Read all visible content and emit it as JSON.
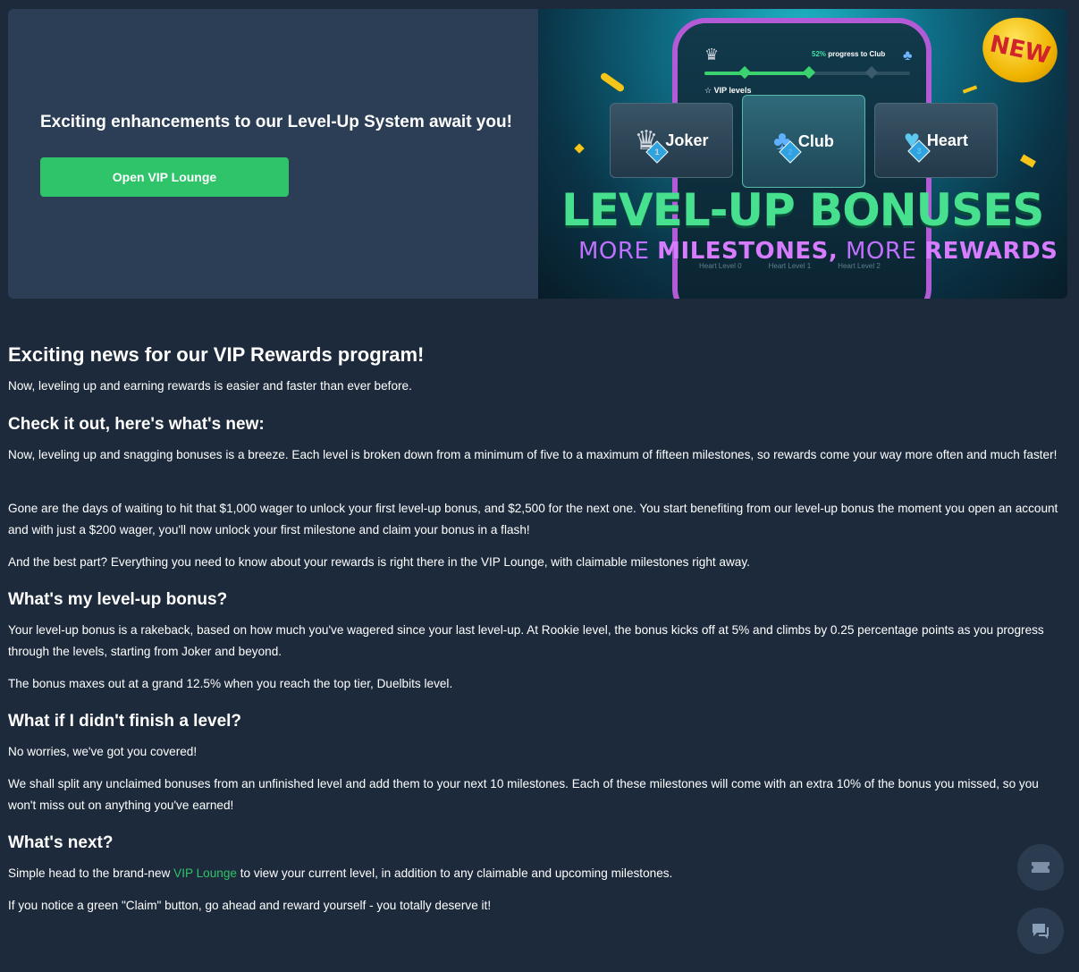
{
  "banner": {
    "title": "Exciting enhancements to our Level-Up System await you!",
    "button_label": "Open VIP Lounge",
    "art": {
      "progress_pct": "52%",
      "progress_suffix": " progress to Club",
      "progress_value": 0.52,
      "vip_levels_label": "VIP levels",
      "cards": [
        {
          "label": "Joker",
          "badge": "1",
          "icon": "crown-icon"
        },
        {
          "label": "Club",
          "badge": "2",
          "icon": "club-icon"
        },
        {
          "label": "Heart",
          "badge": "3",
          "icon": "heart-icon"
        }
      ],
      "headline": "LEVEL-UP BONUSES",
      "subline_more1": "MORE ",
      "subline_milestones": "MILESTONES,",
      "subline_more2": " MORE ",
      "subline_rewards": "REWARDS",
      "heart_levels": [
        "Heart Level 0",
        "Heart Level 1",
        "Heart Level 2"
      ],
      "new_badge": "NEW"
    }
  },
  "article": {
    "h1": "Exciting news for our VIP Rewards program!",
    "p1": "Now, leveling up and earning rewards is easier and faster than ever before.",
    "h2_1": "Check it out, here's what's new:",
    "p2": "Now, leveling up and snagging bonuses is a breeze. Each level is broken down from a minimum of five to a maximum of fifteen milestones, so rewards come your way more often and much faster!",
    "p3": "Gone are the days of waiting to hit that $1,000 wager to unlock your first level-up bonus, and $2,500 for the next one. You start benefiting from our level-up bonus the moment you open an account and with just a $200 wager, you'll now unlock your first milestone and claim your bonus in a flash!",
    "p4": "And the best part? Everything you need to know about your rewards is right there in the VIP Lounge, with claimable milestones right away.",
    "h2_2": "What's my level-up bonus?",
    "p5": "Your level-up bonus is a rakeback, based on how much you've wagered since your last level-up. At Rookie level, the bonus kicks off at 5% and climbs by 0.25 percentage points as you progress through the levels, starting from Joker and beyond.",
    "p6": "The bonus maxes out at a grand 12.5% when you reach the top tier, Duelbits level.",
    "h2_3": "What if I didn't finish a level?",
    "p7": "No worries, we've got you covered!",
    "p8": "We shall split any unclaimed bonuses from an unfinished level and add them to your next 10 milestones. Each of these milestones will come with an extra 10% of the bonus you missed, so you won't miss out on anything you've earned!",
    "h2_4": "What's next?",
    "p9_before": "Simple head to the brand-new ",
    "p9_link": "VIP Lounge",
    "p9_after": " to view your current level, in addition to any claimable and upcoming milestones.",
    "p10": "If you notice a green \"Claim\" button, go ahead and reward yourself - you totally deserve it!"
  },
  "fabs": [
    {
      "icon": "ticket-icon"
    },
    {
      "icon": "chat-icon"
    }
  ],
  "colors": {
    "background": "#1c2a3b",
    "banner": "#2b3e55",
    "accent_green": "#2fc36a"
  }
}
